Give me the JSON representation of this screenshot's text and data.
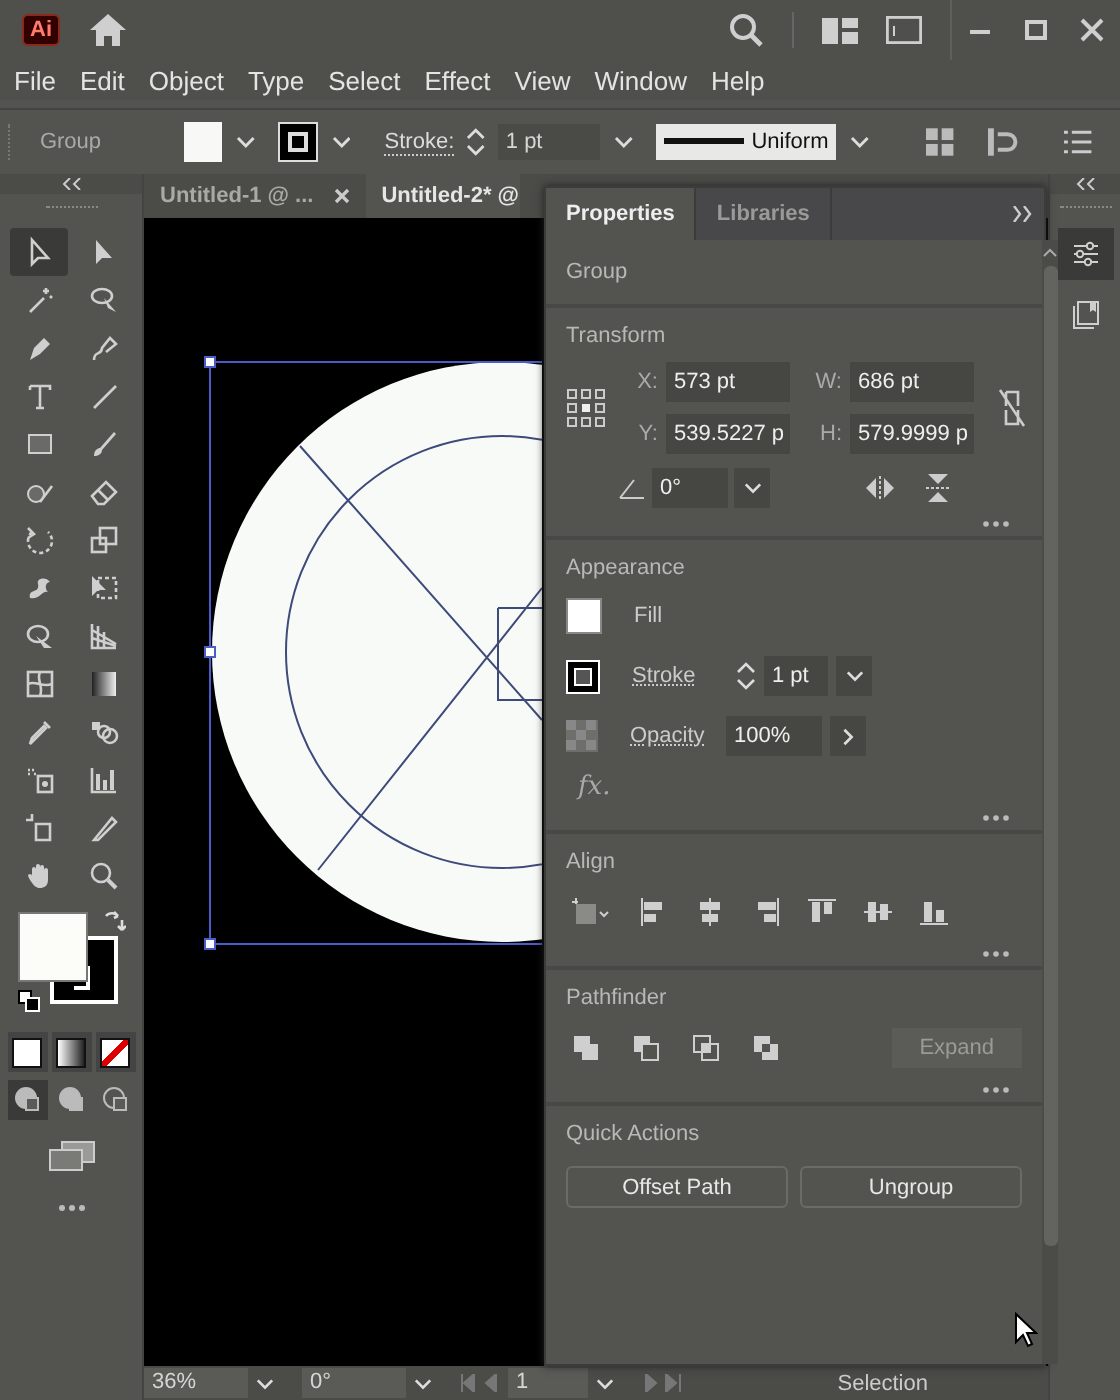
{
  "app": {
    "logo": "Ai"
  },
  "menu": [
    "File",
    "Edit",
    "Object",
    "Type",
    "Select",
    "Effect",
    "View",
    "Window",
    "Help"
  ],
  "control_bar": {
    "selection": "Group",
    "stroke_label": "Stroke:",
    "stroke_weight": "1 pt",
    "profile": "Uniform"
  },
  "tools": [
    {
      "selected": true
    },
    {
      "selected": false
    },
    {
      "selected": false
    },
    {
      "selected": false
    },
    {
      "selected": false
    },
    {
      "selected": false
    },
    {
      "selected": false
    },
    {
      "selected": false
    },
    {
      "selected": false
    },
    {
      "selected": false
    },
    {
      "selected": false
    },
    {
      "selected": false
    },
    {
      "selected": false
    },
    {
      "selected": false
    },
    {
      "selected": false
    },
    {
      "selected": false
    },
    {
      "selected": false
    },
    {
      "selected": false
    },
    {
      "selected": false
    },
    {
      "selected": false
    },
    {
      "selected": false
    },
    {
      "selected": false
    },
    {
      "selected": false
    },
    {
      "selected": false
    },
    {
      "selected": false
    },
    {
      "selected": false
    },
    {
      "selected": false
    },
    {
      "selected": false
    }
  ],
  "draw_modes": [
    {
      "selected": true
    },
    {
      "selected": false
    },
    {
      "selected": false
    }
  ],
  "document_tabs": [
    {
      "title": "Untitled-1 @ ...",
      "selected": false,
      "closable": true
    },
    {
      "title": "Untitled-2* @",
      "selected": true,
      "closable": false
    }
  ],
  "panel": {
    "tabs": [
      {
        "label": "Properties",
        "selected": true
      },
      {
        "label": "Libraries",
        "selected": false
      }
    ],
    "group_label": "Group",
    "transform": {
      "title": "Transform",
      "fields": [
        {
          "label": "X:",
          "value": "573 pt"
        },
        {
          "label": "W:",
          "value": "686 pt"
        },
        {
          "label": "Y:",
          "value": "539.5227 p"
        },
        {
          "label": "H:",
          "value": "579.9999 p"
        }
      ],
      "angle": "0°"
    },
    "appearance": {
      "title": "Appearance",
      "fill_label": "Fill",
      "stroke_label": "Stroke",
      "stroke_weight": "1 pt",
      "opacity_label": "Opacity",
      "opacity": "100%",
      "fx": "fx."
    },
    "align": {
      "title": "Align"
    },
    "pathfinder": {
      "title": "Pathfinder",
      "expand": {
        "label": "Expand",
        "disabled": true
      }
    },
    "quick_actions": {
      "title": "Quick Actions",
      "buttons": [
        "Offset Path",
        "Ungroup"
      ]
    }
  },
  "dock": [
    {
      "selected": true
    },
    {
      "selected": false
    }
  ],
  "status_bar": {
    "zoom": "36%",
    "rotation": "0°",
    "artboard": "1",
    "tool": "Selection"
  }
}
